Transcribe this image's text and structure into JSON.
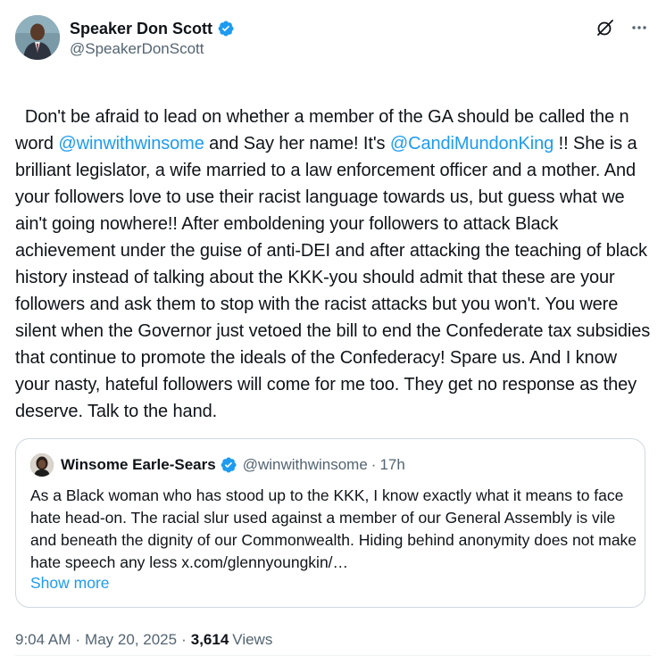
{
  "author": {
    "display_name": "Speaker Don Scott",
    "handle": "@SpeakerDonScott"
  },
  "tweet": {
    "text_parts": [
      {
        "text": "Don't be afraid to lead on whether a member of the GA should be called the n word "
      },
      {
        "text": "@winwithwinsome",
        "mention": true
      },
      {
        "text": " and Say her name! It's "
      },
      {
        "text": "@CandiMundonKing",
        "mention": true
      },
      {
        "text": " !! She is a brilliant legislator, a wife married to a law enforcement officer and a mother. And your followers love to use their racist language towards us, but guess what we ain't going nowhere!! After emboldening your followers to attack Black achievement under the guise of anti-DEI and after attacking the teaching of black history instead of talking about the KKK-you should admit that these are your followers and ask them to stop with the racist attacks but you won't. You were silent when the Governor just vetoed the bill to end the Confederate tax subsidies that continue to promote the ideals of the Confederacy! Spare us. And I know your nasty, hateful followers will come for me too. They get no response as they deserve. Talk to the hand."
      }
    ]
  },
  "quote": {
    "display_name": "Winsome Earle-Sears",
    "handle": "@winwithwinsome",
    "separator": "·",
    "time": "17h",
    "text": "As a Black woman who has stood up to the KKK, I know exactly what it means to face hate head-on. The racial slur used against a member of our General Assembly is vile and beneath the dignity of our Commonwealth. Hiding behind anonymity does not make hate speech any less x.com/glennyoungkin/…",
    "show_more": "Show more"
  },
  "meta": {
    "time": "9:04 AM",
    "sep1": "·",
    "date": "May 20, 2025",
    "sep2": "·",
    "views_count": "3,614",
    "views_label": "Views"
  },
  "colors": {
    "accent": "#1d9bf0",
    "text": "#0f1419",
    "secondary": "#536471",
    "border": "#cfd9de"
  },
  "icons": {
    "verified": "verified-badge-icon",
    "grok": "grok-icon",
    "more": "more-icon"
  }
}
